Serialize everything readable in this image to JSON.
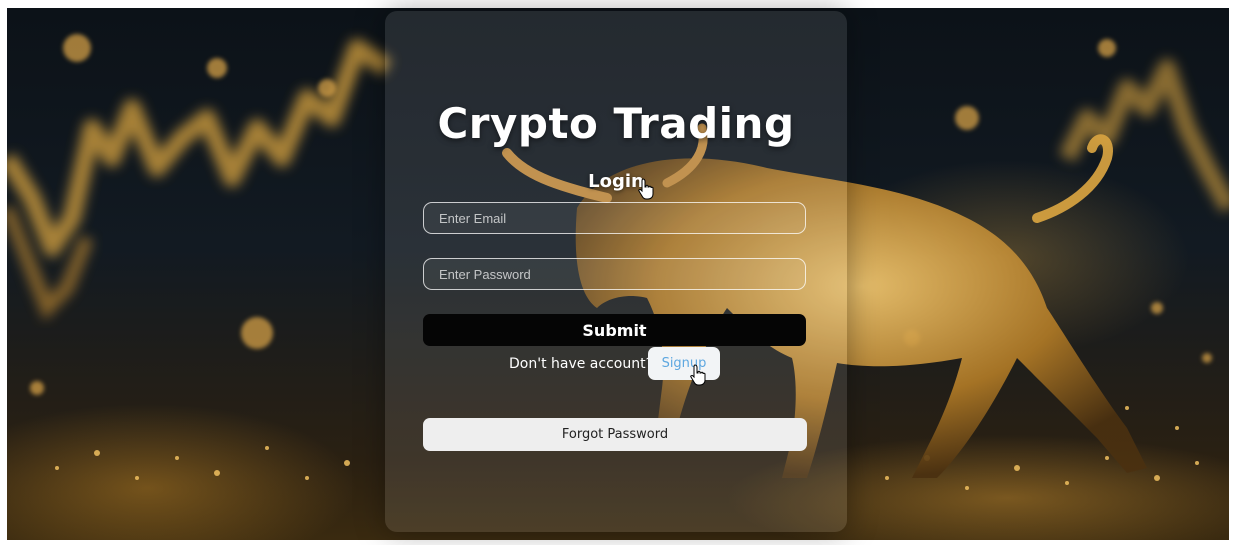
{
  "card": {
    "title": "Crypto Trading",
    "subtitle": "Login"
  },
  "form": {
    "email_placeholder": "Enter Email",
    "password_placeholder": "Enter Password",
    "submit_label": "Submit",
    "signup_prompt": "Don't have account?",
    "signup_label": "Signup",
    "forgot_label": "Forgot Password"
  },
  "colors": {
    "accent_gold": "#d9a441",
    "signup_link": "#5da7e0",
    "submit_bg": "#050505"
  },
  "icons": {
    "pointer": "hand-pointer-icon"
  }
}
